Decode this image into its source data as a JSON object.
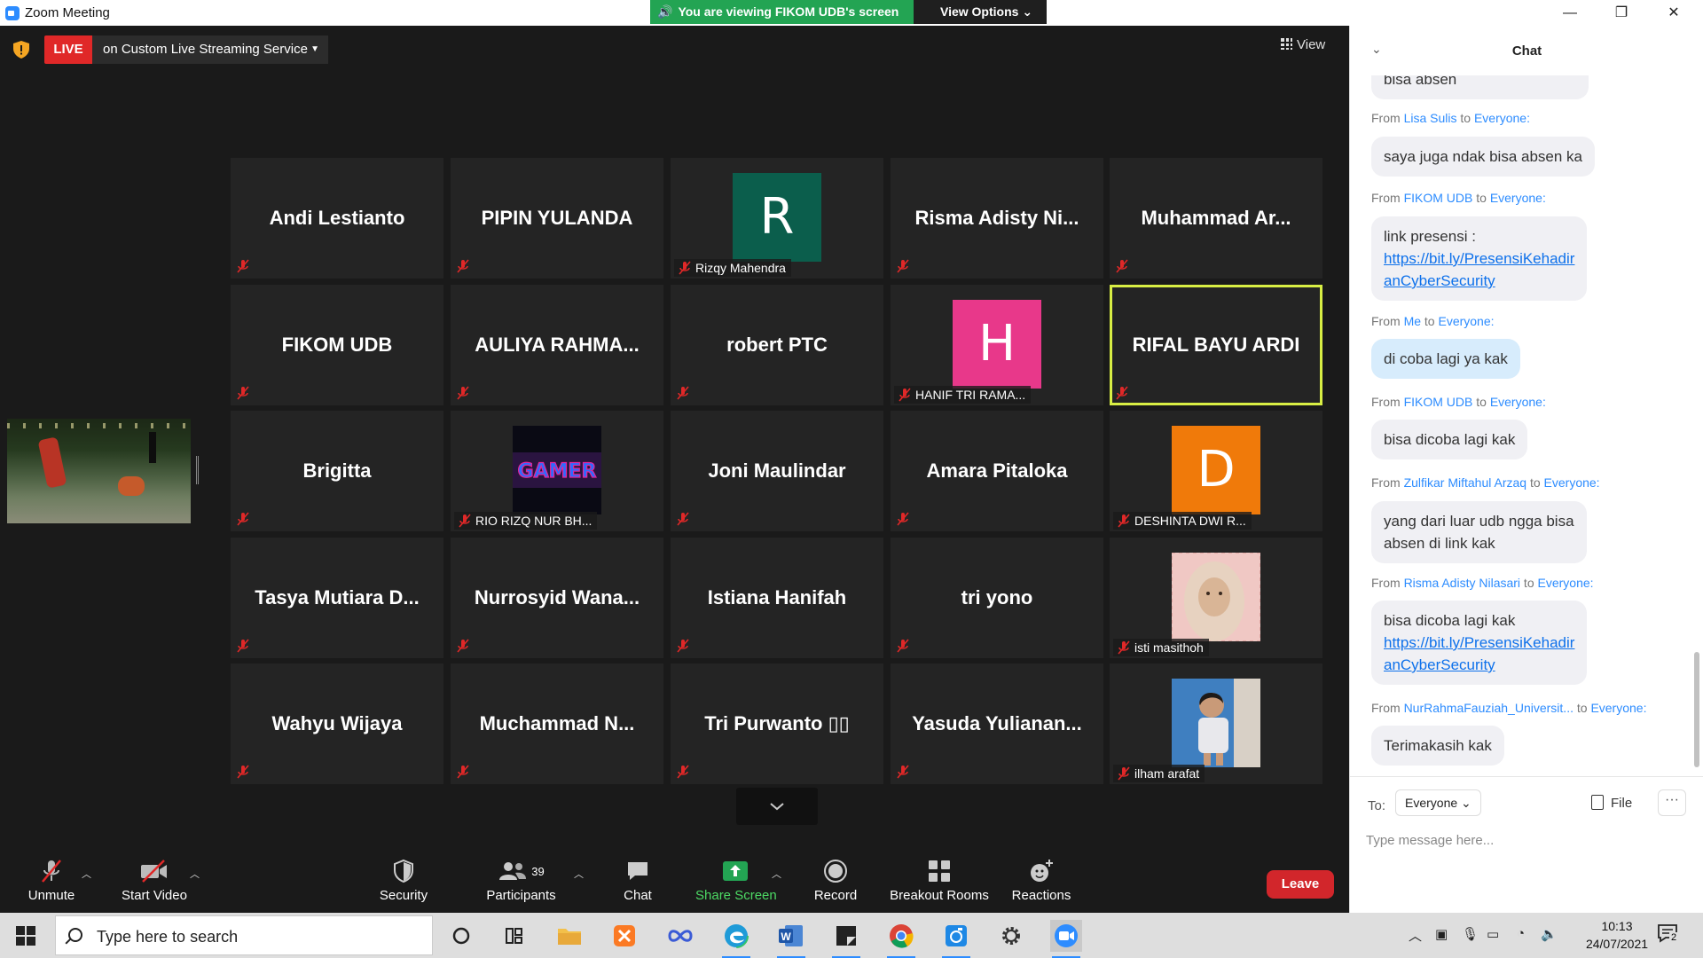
{
  "window": {
    "title": "Zoom Meeting",
    "minimize": "—",
    "maximize": "❐",
    "close": "✕"
  },
  "banner": {
    "viewing": "You are viewing FIKOM UDB's screen",
    "options": "View Options ⌄"
  },
  "live": {
    "badge": "LIVE",
    "service": "on Custom Live Streaming Service"
  },
  "view_button": "View",
  "tiles": [
    {
      "name": "Andi Lestianto"
    },
    {
      "name": "PIPIN YULANDA"
    },
    {
      "avatar_letter": "R",
      "avatar_color": "#0b5e4c",
      "label": "Rizqy Mahendra"
    },
    {
      "name": "Risma Adisty Ni..."
    },
    {
      "name": "Muhammad Ar..."
    },
    {
      "name": "FIKOM UDB"
    },
    {
      "name": "AULIYA RAHMA..."
    },
    {
      "name": "robert PTC"
    },
    {
      "avatar_letter": "H",
      "avatar_color": "#e8388a",
      "label": "HANIF TRI RAMA..."
    },
    {
      "name": "RIFAL BAYU ARDI",
      "speaking": true
    },
    {
      "name": "Brigitta"
    },
    {
      "photo": "gamer-logo",
      "label": "RIO RIZQ NUR BH..."
    },
    {
      "name": "Joni Maulindar"
    },
    {
      "name": "Amara Pitaloka"
    },
    {
      "avatar_letter": "D",
      "avatar_color": "#f07a0a",
      "label": "DESHINTA DWI R..."
    },
    {
      "name": "Tasya Mutiara D..."
    },
    {
      "name": "Nurrosyid Wana..."
    },
    {
      "name": "Istiana Hanifah"
    },
    {
      "name": "tri yono"
    },
    {
      "photo": "woman-hijab",
      "label": "isti masithoh"
    },
    {
      "name": "Wahyu Wijaya"
    },
    {
      "name": "Muchammad N..."
    },
    {
      "name": "Tri Purwanto ▯▯"
    },
    {
      "name": "Yasuda Yulianan..."
    },
    {
      "photo": "child",
      "label": "ilham arafat"
    }
  ],
  "toolbar": {
    "unmute": "Unmute",
    "start_video": "Start Video",
    "security": "Security",
    "participants": "Participants",
    "participants_count": "39",
    "chat": "Chat",
    "share_screen": "Share Screen",
    "record": "Record",
    "breakout_rooms": "Breakout Rooms",
    "reactions": "Reactions",
    "leave": "Leave"
  },
  "chat": {
    "title": "Chat",
    "partial_top": "bisa absen",
    "messages": [
      {
        "from": "Lisa Sulis",
        "to": "Everyone:",
        "lines": [
          "saya juga ndak bisa absen ka"
        ]
      },
      {
        "from": "FIKOM UDB",
        "to": "Everyone:",
        "lines": [
          "link presensi :"
        ],
        "link": [
          "https://bit.ly/PresensiKehadir",
          "anCyberSecurity"
        ]
      },
      {
        "from": "Me",
        "to": "Everyone:",
        "lines": [
          "di coba lagi ya kak"
        ],
        "me": true
      },
      {
        "from": "FIKOM UDB",
        "to": "Everyone:",
        "lines": [
          "bisa dicoba lagi kak"
        ]
      },
      {
        "from": "Zulfikar Miftahul Arzaq",
        "to": "Everyone:",
        "lines": [
          "yang dari luar udb ngga bisa",
          "absen di link kak"
        ]
      },
      {
        "from": "Risma Adisty Nilasari",
        "to": "Everyone:",
        "lines": [
          "bisa dicoba lagi kak"
        ],
        "link": [
          "https://bit.ly/PresensiKehadir",
          "anCyberSecurity"
        ]
      },
      {
        "from": "NurRahmaFauziah_Universit...",
        "to": "Everyone:",
        "lines": [
          "Terimakasih kak"
        ]
      }
    ],
    "from_prefix": "From",
    "to_word": "to",
    "to_label": "To:",
    "to_value": "Everyone",
    "file": "File",
    "more": "···",
    "placeholder": "Type message here..."
  },
  "taskbar": {
    "search": "Type here to search",
    "time": "10:13",
    "date": "24/07/2021",
    "notifications": "2"
  }
}
